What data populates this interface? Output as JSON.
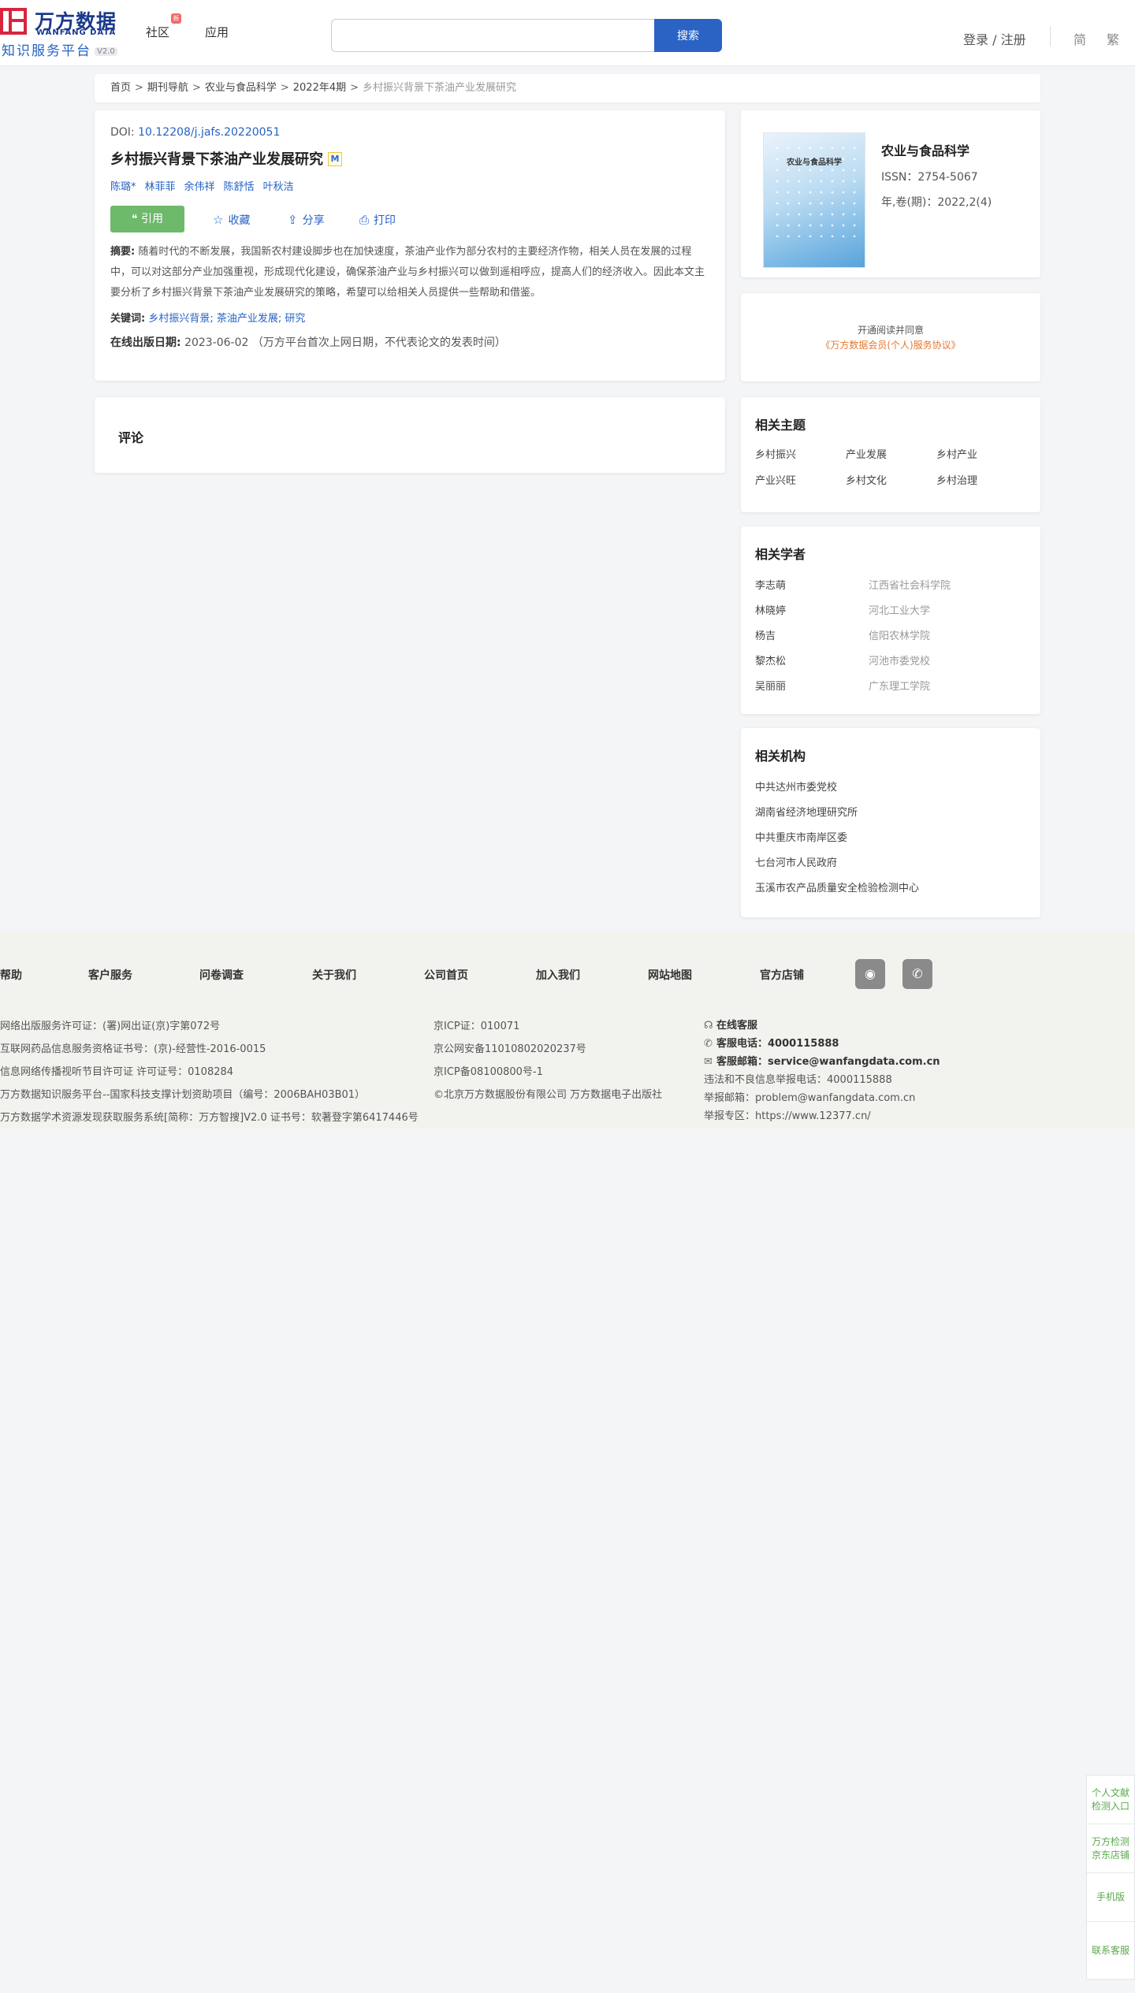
{
  "header": {
    "logo_cn": "万方数据",
    "logo_en": "WANFANG DATA",
    "logo_sub": "知识服务平台",
    "logo_version": "V2.0",
    "nav": [
      {
        "label": "社区"
      },
      {
        "label": "应用"
      }
    ],
    "community_badge": "新",
    "search_placeholder": "",
    "search_button": "搜索",
    "login": "登录 / 注册",
    "lang_simplified": "简",
    "lang_traditional": "繁"
  },
  "breadcrumb": {
    "items": [
      "首页",
      "期刊导航",
      "农业与食品科学",
      "2022年4期"
    ],
    "separator": ">",
    "current": "乡村振兴背景下茶油产业发展研究"
  },
  "article": {
    "doi_label": "DOI:",
    "doi": "10.12208/j.jafs.20220051",
    "title": "乡村振兴背景下茶油产业发展研究",
    "m_badge": "M",
    "authors": [
      "陈璐*",
      "林菲菲",
      "余伟祥",
      "陈舒恬",
      "叶秋洁"
    ],
    "actions": {
      "cite": "引用",
      "favorite": "收藏",
      "share": "分享",
      "print": "打印"
    },
    "abstract_label": "摘要:",
    "abstract": "随着时代的不断发展，我国新农村建设脚步也在加快速度，茶油产业作为部分农村的主要经济作物，相关人员在发展的过程中，可以对这部分产业加强重视，形成现代化建设，确保茶油产业与乡村振兴可以做到遥相呼应，提高人们的经济收入。因此本文主要分析了乡村振兴背景下茶油产业发展研究的策略，希望可以给相关人员提供一些帮助和借鉴。",
    "keywords_label": "关键词:",
    "keywords": "乡村振兴背景; 茶油产业发展; 研究",
    "pubdate_label": "在线出版日期:",
    "pubdate": "2023-06-02",
    "pubdate_note": "（万方平台首次上网日期，不代表论文的发表时间）"
  },
  "comment": {
    "title": "评论"
  },
  "journal": {
    "cover_title": "农业与食品科学",
    "name": "农业与食品科学",
    "issn": "ISSN：2754-5067",
    "volume": "年,卷(期)：2022,2(4)"
  },
  "member": {
    "line1": "开通阅读并同意",
    "link": "《万方数据会员(个人)服务协议》"
  },
  "topics": {
    "title": "相关主题",
    "items": [
      "乡村振兴",
      "产业发展",
      "乡村产业",
      "产业兴旺",
      "乡村文化",
      "乡村治理"
    ]
  },
  "scholars": {
    "title": "相关学者",
    "items": [
      {
        "name": "李志萌",
        "org": "江西省社会科学院"
      },
      {
        "name": "林晓婷",
        "org": "河北工业大学"
      },
      {
        "name": "杨吉",
        "org": "信阳农林学院"
      },
      {
        "name": "黎杰松",
        "org": "河池市委党校"
      },
      {
        "name": "吴丽丽",
        "org": "广东理工学院"
      }
    ]
  },
  "orgs": {
    "title": "相关机构",
    "items": [
      "中共达州市委党校",
      "湖南省经济地理研究所",
      "中共重庆市南岸区委",
      "七台河市人民政府",
      "玉溪市农产品质量安全检验检测中心"
    ]
  },
  "footer": {
    "links": [
      "帮助",
      "客户服务",
      "问卷调查",
      "关于我们",
      "公司首页",
      "加入我们",
      "网站地图",
      "官方店铺"
    ],
    "col1": [
      "网络出版服务许可证：(署)网出证(京)字第072号",
      "互联网药品信息服务资格证书号：(京)-经营性-2016-0015",
      "信息网络传播视听节目许可证 许可证号：0108284",
      "万方数据知识服务平台--国家科技支撑计划资助项目（编号：2006BAH03B01）",
      "万方数据学术资源发现获取服务系统[简称：万方智搜]V2.0 证书号：软著登字第6417446号"
    ],
    "col2": [
      "京ICP证：010071",
      "京公网安备11010802020237号",
      "京ICP备08100800号-1",
      "©北京万方数据股份有限公司 万方数据电子出版社"
    ],
    "col3": {
      "online": "在线客服",
      "phone_label": "客服电话：",
      "phone": "4000115888",
      "email_label": "客服邮箱：",
      "email": "service@wanfangdata.com.cn",
      "report_phone": "违法和不良信息举报电话：4000115888",
      "report_email": "举报邮箱：problem@wanfangdata.com.cn",
      "report_zone": "举报专区：https://www.12377.cn/"
    }
  },
  "sidebar": {
    "items": [
      "个人文献检测入口",
      "万方检测京东店铺",
      "手机版",
      "联系客服"
    ]
  }
}
